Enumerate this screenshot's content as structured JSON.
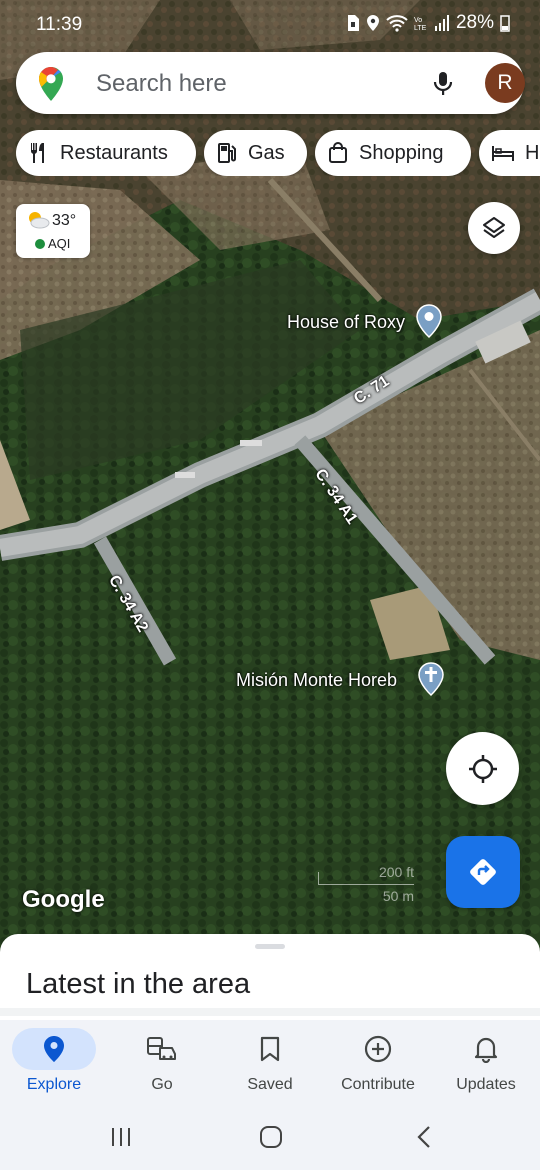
{
  "status_bar": {
    "time": "11:39",
    "battery": "28%",
    "icons": [
      "sim-icon",
      "location-icon",
      "wifi-icon",
      "volte-icon",
      "signal-icon",
      "battery-icon"
    ]
  },
  "search": {
    "placeholder": "Search here",
    "avatar_letter": "R",
    "avatar_color": "#7a3b1f"
  },
  "chips": [
    {
      "label": "Restaurants",
      "icon": "restaurant-icon"
    },
    {
      "label": "Gas",
      "icon": "gas-station-icon"
    },
    {
      "label": "Shopping",
      "icon": "shopping-bag-icon"
    },
    {
      "label": "Hotels",
      "icon": "bed-icon"
    }
  ],
  "weather": {
    "temperature": "33°",
    "aqi_label": "AQI",
    "aqi_color": "#1e8e3e",
    "icon": "partly-cloudy-icon"
  },
  "map": {
    "places": [
      {
        "name": "House of Roxy",
        "icon": "place-pin-icon"
      },
      {
        "name": "Misión Monte Horeb",
        "icon": "church-pin-icon"
      }
    ],
    "roads": [
      "C. 71",
      "C. 34 A1",
      "C. 34 A2"
    ],
    "attribution": "Google",
    "scale": {
      "feet": "200 ft",
      "meters": "50 m"
    }
  },
  "buttons": {
    "layers": "layers-icon",
    "my_location": "my-location-icon",
    "directions": "directions-icon",
    "directions_color": "#1a73e8"
  },
  "sheet": {
    "title": "Latest in the area"
  },
  "bottom_nav": [
    {
      "label": "Explore",
      "icon": "explore-pin-icon",
      "active": true
    },
    {
      "label": "Go",
      "icon": "commute-icon",
      "active": false
    },
    {
      "label": "Saved",
      "icon": "bookmark-icon",
      "active": false
    },
    {
      "label": "Contribute",
      "icon": "add-circle-icon",
      "active": false
    },
    {
      "label": "Updates",
      "icon": "bell-icon",
      "active": false
    }
  ],
  "accent_color": "#0b57d0"
}
